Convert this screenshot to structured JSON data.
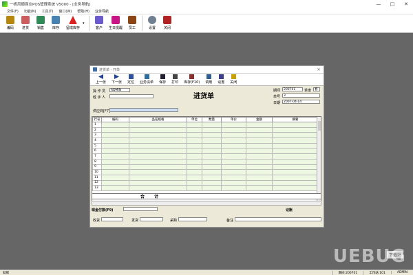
{
  "window": {
    "title": "一帆风顺商业POS管理系统 V5000 - [业务导航]",
    "controls": [
      "—",
      "□",
      "✕"
    ]
  },
  "menu": [
    "文件(F)",
    "功能(N)",
    "工具(T)",
    "窗口(W)",
    "帮助(H)",
    "业务导航"
  ],
  "toolbar": [
    {
      "label": "编码",
      "icon": "code-icon",
      "color": "#b8860b"
    },
    {
      "label": "进货",
      "icon": "purchase-icon",
      "color": "#cd5c5c"
    },
    {
      "label": "销售",
      "icon": "sales-icon",
      "color": "#2e8b57"
    },
    {
      "label": "库存",
      "icon": "stock-icon",
      "color": "#4682b4"
    },
    {
      "label": "留成库存",
      "icon": "warning-icon",
      "color": "#d22"
    },
    {
      "label": "客户",
      "icon": "customer-icon",
      "color": "#6a5acd"
    },
    {
      "label": "生日提醒",
      "icon": "birthday-icon",
      "color": "#c71585"
    },
    {
      "label": "员工",
      "icon": "staff-icon",
      "color": "#8b4513"
    },
    {
      "label": "设置",
      "icon": "settings-icon",
      "color": "#708090"
    },
    {
      "label": "关闭",
      "icon": "exit-icon",
      "color": "#b22222"
    }
  ],
  "doc_window": {
    "title": "进货单 - 开单",
    "toolbar": [
      {
        "label": "上一张",
        "icon": "prev-icon"
      },
      {
        "label": "下一张",
        "icon": "next-icon"
      },
      {
        "label": "定位",
        "icon": "locate-icon"
      },
      {
        "label": "业务清单",
        "icon": "list-icon"
      },
      {
        "label": "保存",
        "icon": "save-icon"
      },
      {
        "label": "打印",
        "icon": "print-icon"
      },
      {
        "label": "库存(F10)",
        "icon": "stock-icon"
      },
      {
        "label": "调用",
        "icon": "call-icon"
      },
      {
        "label": "设置",
        "icon": "settings-icon"
      },
      {
        "label": "关闭",
        "icon": "close-icon"
      }
    ],
    "heading": "进货单",
    "operator_label": "操 作 员",
    "operator_value": "ADMIN",
    "handler_label": "经 手 人",
    "handler_value": "",
    "supplier_label": "供应商[F7]",
    "period_label": "期间",
    "period_value": "200701",
    "quarter_label": "季度",
    "quarter_value": "春",
    "doc_no_label": "单号",
    "doc_no_value": "3",
    "date_label": "日期",
    "date_value": "2007-04-14",
    "columns": [
      "行号",
      "编码",
      "品名规格",
      "单位",
      "数量",
      "单价",
      "金额",
      "摘要"
    ],
    "rows": [
      "1",
      "2",
      "3",
      "4",
      "5",
      "6",
      "7",
      "8",
      "9",
      "10",
      "11",
      "12",
      "13"
    ],
    "total_label": "合  计",
    "cash_label": "现金付款(F9)",
    "posting_label": "记账",
    "receiver_label": "收货",
    "shipper_label": "发货",
    "purchaser_label": "采购",
    "remark_label": "备注"
  },
  "status": {
    "left": "就绪",
    "period": "期间:200701",
    "workstation": "工作站:101",
    "user": "ADMIN"
  },
  "watermark": "UEBUG",
  "watermark_sub": "下载站"
}
